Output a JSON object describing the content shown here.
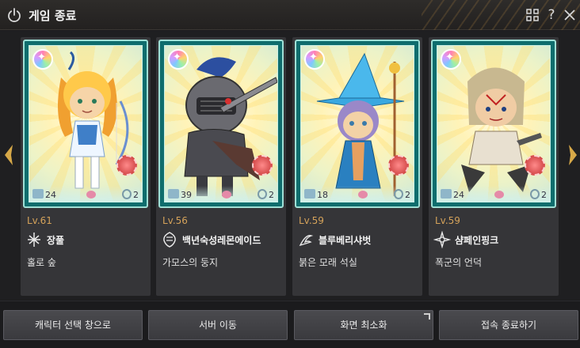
{
  "window": {
    "title": "게임 종료",
    "icons": [
      "power-icon",
      "grid-icon",
      "help-icon",
      "close-icon"
    ],
    "accent": "#d4a25a"
  },
  "characters": [
    {
      "level": "Lv.61",
      "name": "장풀",
      "location": "홀로 숲",
      "stat_left": "24",
      "stat_right": "2",
      "class_icon": "sword-wing-icon"
    },
    {
      "level": "Lv.56",
      "name": "백년숙성레몬에이드",
      "location": "가모스의 둥지",
      "stat_left": "39",
      "stat_right": "2",
      "class_icon": "guardian-icon"
    },
    {
      "level": "Lv.59",
      "name": "블루베리샤벗",
      "location": "붉은 모래 석실",
      "stat_left": "18",
      "stat_right": "2",
      "class_icon": "mage-icon"
    },
    {
      "level": "Lv.59",
      "name": "샴페인핑크",
      "location": "폭군의 언덕",
      "stat_left": "24",
      "stat_right": "2",
      "class_icon": "star-icon"
    }
  ],
  "buttons": {
    "char_select": "캐릭터 선택 창으로",
    "server_move": "서버 이동",
    "minimize": "화면 최소화",
    "quit": "접속 종료하기"
  }
}
